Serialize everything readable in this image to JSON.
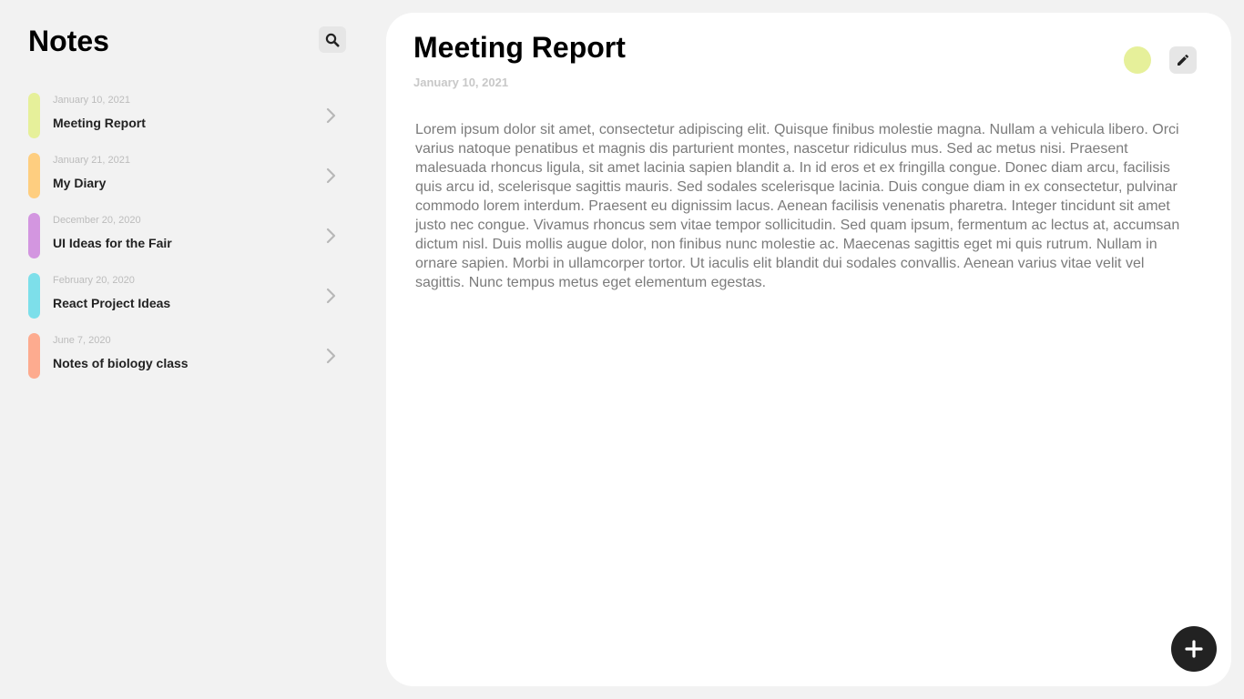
{
  "sidebar": {
    "title": "Notes",
    "search_icon": "search-icon",
    "notes": [
      {
        "date": "January 10, 2021",
        "title": "Meeting Report",
        "color": "#e6f09a"
      },
      {
        "date": "January 21, 2021",
        "title": "My Diary",
        "color": "#fece80"
      },
      {
        "date": "December 20, 2020",
        "title": "UI Ideas for the Fair",
        "color": "#d396e0"
      },
      {
        "date": "February 20, 2020",
        "title": "React Project Ideas",
        "color": "#7ddfea"
      },
      {
        "date": "June 7, 2020",
        "title": "Notes of biology class",
        "color": "#fdab8f"
      }
    ]
  },
  "main": {
    "title": "Meeting Report",
    "date": "January 10, 2021",
    "color": "#e6f09a",
    "edit_icon": "pencil-icon",
    "body": "Lorem ipsum dolor sit amet, consectetur adipiscing elit. Quisque finibus molestie magna. Nullam a vehicula libero. Orci varius natoque penatibus et magnis dis parturient montes, nascetur ridiculus mus. Sed ac metus nisi. Praesent malesuada rhoncus ligula, sit amet lacinia sapien blandit a. In id eros et ex fringilla congue. Donec diam arcu, facilisis quis arcu id, scelerisque sagittis mauris. Sed sodales scelerisque lacinia. Duis congue diam in ex consectetur, pulvinar commodo lorem interdum. Praesent eu dignissim lacus. Aenean facilisis venenatis pharetra. Integer tincidunt sit amet justo nec congue. Vivamus rhoncus sem vitae tempor sollicitudin. Sed quam ipsum, fermentum ac lectus at, accumsan dictum nisl. Duis mollis augue dolor, non finibus nunc molestie ac. Maecenas sagittis eget mi quis rutrum. Nullam in ornare sapien. Morbi in ullamcorper tortor. Ut iaculis elit blandit dui sodales convallis. Aenean varius vitae velit vel sagittis. Nunc tempus metus eget elementum egestas."
  },
  "fab": {
    "icon": "plus-icon"
  }
}
